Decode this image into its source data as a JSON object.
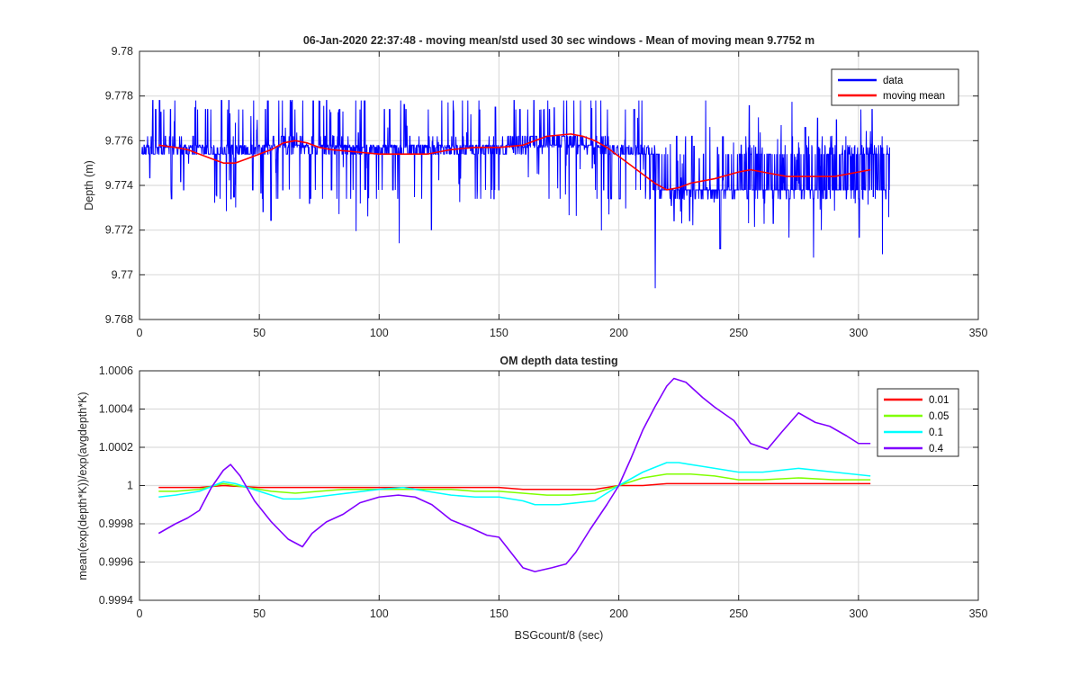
{
  "chart_data": [
    {
      "type": "line",
      "title": "06-Jan-2020 22:37:48 - moving mean/std used 30 sec windows - Mean of moving mean 9.7752 m",
      "xlabel": "",
      "ylabel": "Depth (m)",
      "xlim": [
        0,
        350
      ],
      "ylim": [
        9.768,
        9.78
      ],
      "xticks": [
        0,
        50,
        100,
        150,
        200,
        250,
        300,
        350
      ],
      "xtick_labels": [
        "0",
        "50",
        "100",
        "150",
        "200",
        "250",
        "300",
        "350"
      ],
      "yticks": [
        9.768,
        9.77,
        9.772,
        9.774,
        9.776,
        9.778,
        9.78
      ],
      "ytick_labels": [
        "9.768",
        "9.77",
        "9.772",
        "9.774",
        "9.776",
        "9.778",
        "9.78"
      ],
      "grid": true,
      "legend_position": "top-right",
      "series": [
        {
          "name": "data",
          "color": "#0000ff",
          "style": "noisy",
          "x_range": [
            1,
            313
          ],
          "base": [
            [
              1,
              9.7754
            ],
            [
              7,
              9.7758
            ],
            [
              15,
              9.7757
            ],
            [
              25,
              9.7754
            ],
            [
              38,
              9.775
            ],
            [
              45,
              9.7753
            ],
            [
              55,
              9.7757
            ],
            [
              65,
              9.7759
            ],
            [
              75,
              9.7757
            ],
            [
              90,
              9.7755
            ],
            [
              110,
              9.7754
            ],
            [
              130,
              9.7756
            ],
            [
              150,
              9.7757
            ],
            [
              165,
              9.7759
            ],
            [
              180,
              9.7761
            ],
            [
              195,
              9.7758
            ],
            [
              205,
              9.7752
            ],
            [
              215,
              9.7747
            ],
            [
              225,
              9.7739
            ],
            [
              240,
              9.7743
            ],
            [
              255,
              9.7746
            ],
            [
              270,
              9.7744
            ],
            [
              290,
              9.7745
            ],
            [
              305,
              9.7747
            ],
            [
              313,
              9.7746
            ]
          ],
          "levels": [
            9.7734,
            9.7738,
            9.7754,
            9.7757,
            9.7758,
            9.7762,
            9.7774,
            9.7778
          ],
          "min": 9.7694,
          "max": 9.7778
        },
        {
          "name": "moving mean",
          "color": "#ff0000",
          "x": [
            8,
            15,
            20,
            25,
            30,
            35,
            40,
            45,
            50,
            55,
            60,
            65,
            70,
            75,
            80,
            90,
            100,
            110,
            120,
            130,
            140,
            150,
            160,
            165,
            170,
            180,
            185,
            190,
            195,
            200,
            205,
            210,
            215,
            220,
            225,
            230,
            240,
            250,
            255,
            260,
            270,
            275,
            280,
            290,
            300,
            305
          ],
          "y": [
            9.7758,
            9.7757,
            9.7756,
            9.7754,
            9.7752,
            9.775,
            9.775,
            9.7752,
            9.7754,
            9.7756,
            9.7759,
            9.776,
            9.7759,
            9.7757,
            9.7756,
            9.7755,
            9.7754,
            9.7754,
            9.7754,
            9.7756,
            9.7757,
            9.7757,
            9.7758,
            9.776,
            9.7762,
            9.7763,
            9.7762,
            9.776,
            9.7757,
            9.7753,
            9.7749,
            9.7745,
            9.7741,
            9.7738,
            9.7739,
            9.7741,
            9.7743,
            9.7746,
            9.7747,
            9.7746,
            9.7744,
            9.7744,
            9.7744,
            9.7744,
            9.7746,
            9.7747
          ]
        }
      ]
    },
    {
      "type": "line",
      "title": "OM depth data testing",
      "xlabel": "BSGcount/8 (sec)",
      "ylabel": "mean(exp(depth*K))/exp(avgdepth*K)",
      "xlim": [
        0,
        350
      ],
      "ylim": [
        0.9994,
        1.0006
      ],
      "xticks": [
        0,
        50,
        100,
        150,
        200,
        250,
        300,
        350
      ],
      "xtick_labels": [
        "0",
        "50",
        "100",
        "150",
        "200",
        "250",
        "300",
        "350"
      ],
      "yticks": [
        0.9994,
        0.9996,
        0.9998,
        1.0,
        1.0002,
        1.0004,
        1.0006
      ],
      "ytick_labels": [
        "0.9994",
        "0.9996",
        "0.9998",
        "1",
        "1.0002",
        "1.0004",
        "1.0006"
      ],
      "grid": true,
      "legend_position": "top-right",
      "series": [
        {
          "name": "0.01",
          "color": "#ff0000",
          "x": [
            8,
            25,
            35,
            50,
            60,
            80,
            100,
            120,
            150,
            160,
            170,
            180,
            190,
            200,
            210,
            220,
            240,
            260,
            280,
            305
          ],
          "y": [
            0.99999,
            0.99999,
            1.0,
            0.99999,
            0.99999,
            0.99999,
            0.99999,
            0.99999,
            0.99999,
            0.99998,
            0.99998,
            0.99998,
            0.99998,
            1.0,
            1.0,
            1.00001,
            1.00001,
            1.00001,
            1.00001,
            1.00001
          ]
        },
        {
          "name": "0.05",
          "color": "#80ff00",
          "x": [
            8,
            15,
            25,
            35,
            45,
            55,
            65,
            75,
            85,
            100,
            110,
            120,
            130,
            140,
            150,
            160,
            170,
            180,
            190,
            200,
            210,
            220,
            230,
            240,
            250,
            260,
            275,
            290,
            305
          ],
          "y": [
            0.99997,
            0.99997,
            0.99998,
            1.00001,
            0.99999,
            0.99997,
            0.99996,
            0.99997,
            0.99998,
            0.99998,
            0.99998,
            0.99998,
            0.99998,
            0.99997,
            0.99997,
            0.99996,
            0.99995,
            0.99995,
            0.99996,
            1.0,
            1.00004,
            1.00006,
            1.00006,
            1.00005,
            1.00003,
            1.00003,
            1.00004,
            1.00003,
            1.00003
          ]
        },
        {
          "name": "0.1",
          "color": "#00ffff",
          "x": [
            8,
            15,
            25,
            35,
            40,
            50,
            60,
            67,
            80,
            100,
            110,
            120,
            130,
            140,
            150,
            160,
            165,
            175,
            190,
            200,
            210,
            220,
            225,
            235,
            250,
            260,
            275,
            290,
            305
          ],
          "y": [
            0.99994,
            0.99995,
            0.99997,
            1.00002,
            1.00001,
            0.99997,
            0.99993,
            0.99993,
            0.99995,
            0.99998,
            0.99999,
            0.99997,
            0.99995,
            0.99994,
            0.99994,
            0.99992,
            0.9999,
            0.9999,
            0.99992,
            1.0,
            1.00007,
            1.00012,
            1.00012,
            1.0001,
            1.00007,
            1.00007,
            1.00009,
            1.00007,
            1.00005
          ]
        },
        {
          "name": "0.4",
          "color": "#8000ff",
          "x": [
            8,
            15,
            20,
            25,
            30,
            35,
            38,
            42,
            48,
            55,
            62,
            68,
            72,
            78,
            85,
            92,
            100,
            108,
            115,
            122,
            130,
            138,
            145,
            150,
            155,
            160,
            165,
            172,
            178,
            182,
            188,
            195,
            200,
            205,
            210,
            215,
            220,
            223,
            228,
            235,
            240,
            248,
            255,
            262,
            268,
            275,
            282,
            288,
            295,
            300,
            305
          ],
          "y": [
            0.99975,
            0.9998,
            0.99983,
            0.99987,
            0.99999,
            1.00008,
            1.00011,
            1.00005,
            0.99992,
            0.99981,
            0.99972,
            0.99968,
            0.99975,
            0.99981,
            0.99985,
            0.99991,
            0.99994,
            0.99995,
            0.99994,
            0.9999,
            0.99982,
            0.99978,
            0.99974,
            0.99973,
            0.99965,
            0.99957,
            0.99955,
            0.99957,
            0.99959,
            0.99965,
            0.99977,
            0.9999,
            1.0,
            1.00014,
            1.00029,
            1.00041,
            1.00052,
            1.00056,
            1.00054,
            1.00046,
            1.00041,
            1.00034,
            1.00022,
            1.00019,
            1.00028,
            1.00038,
            1.00033,
            1.00031,
            1.00026,
            1.00022,
            1.00022
          ]
        }
      ]
    }
  ]
}
